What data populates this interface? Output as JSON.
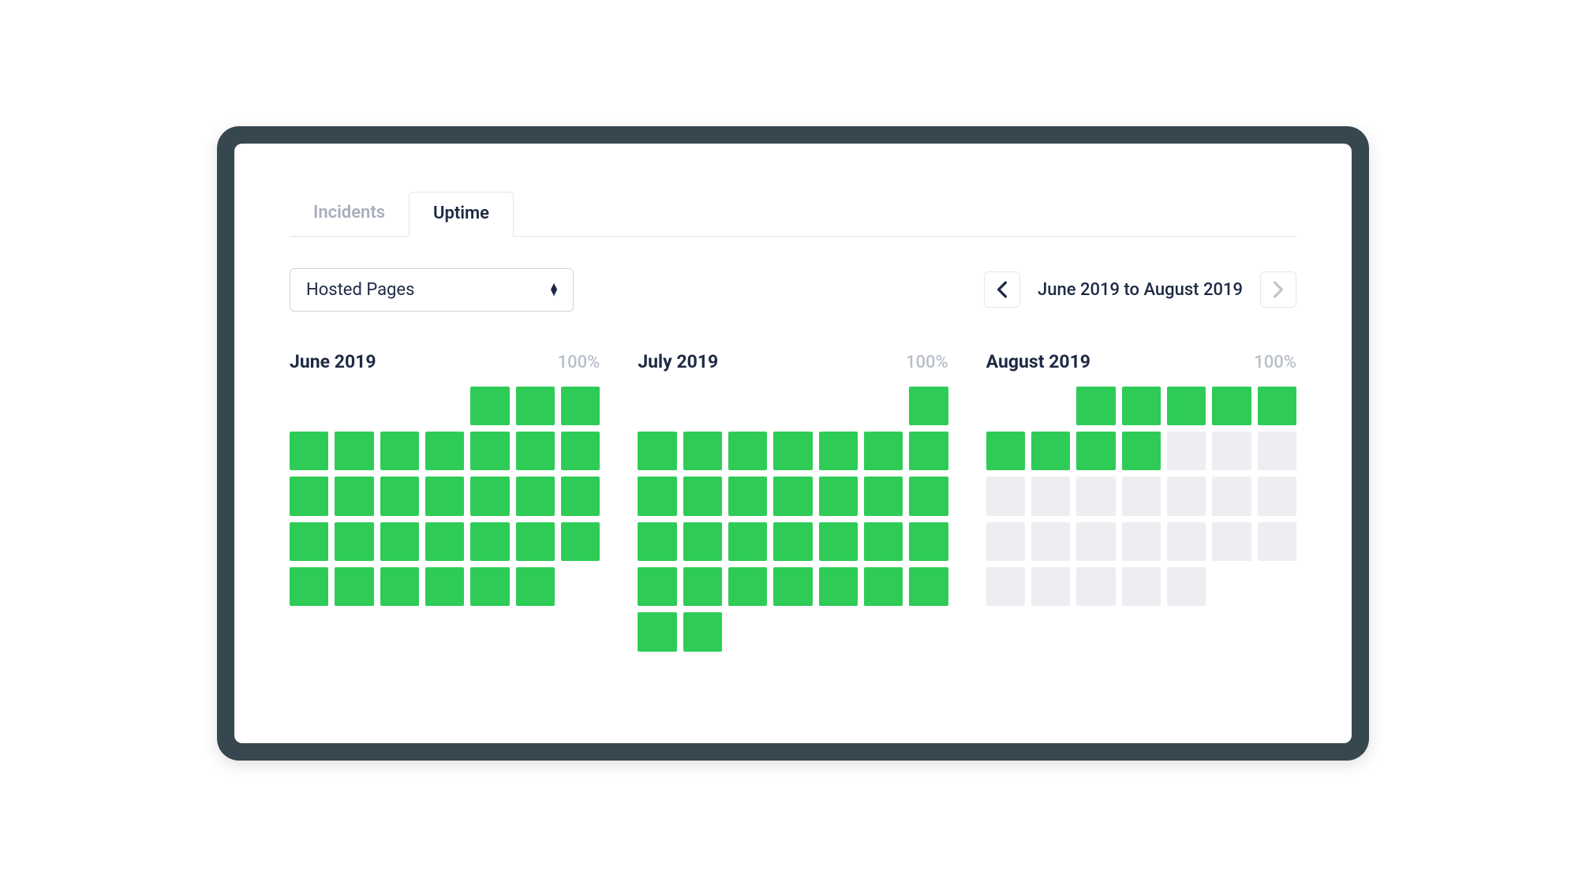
{
  "tabs": [
    {
      "id": "incidents",
      "label": "Incidents",
      "active": false
    },
    {
      "id": "uptime",
      "label": "Uptime",
      "active": true
    }
  ],
  "filter": {
    "selected": "Hosted Pages"
  },
  "range": {
    "label": "June 2019 to August 2019"
  },
  "colors": {
    "up": "#2ecc56",
    "none": "#eceef1"
  },
  "months": [
    {
      "title": "June 2019",
      "percent": "100%",
      "offset": 4,
      "days": [
        "up",
        "up",
        "up",
        "up",
        "up",
        "up",
        "up",
        "up",
        "up",
        "up",
        "up",
        "up",
        "up",
        "up",
        "up",
        "up",
        "up",
        "up",
        "up",
        "up",
        "up",
        "up",
        "up",
        "up",
        "up",
        "up",
        "up",
        "up",
        "up",
        "up"
      ]
    },
    {
      "title": "July 2019",
      "percent": "100%",
      "offset": 6,
      "days": [
        "up",
        "up",
        "up",
        "up",
        "up",
        "up",
        "up",
        "up",
        "up",
        "up",
        "up",
        "up",
        "up",
        "up",
        "up",
        "up",
        "up",
        "up",
        "up",
        "up",
        "up",
        "up",
        "up",
        "up",
        "up",
        "up",
        "up",
        "up",
        "up",
        "up",
        "up"
      ]
    },
    {
      "title": "August 2019",
      "percent": "100%",
      "offset": 2,
      "days": [
        "up",
        "up",
        "up",
        "up",
        "up",
        "up",
        "up",
        "up",
        "up",
        "none",
        "none",
        "none",
        "none",
        "none",
        "none",
        "none",
        "none",
        "none",
        "none",
        "none",
        "none",
        "none",
        "none",
        "none",
        "none",
        "none",
        "none",
        "none",
        "none",
        "none",
        "none"
      ]
    }
  ]
}
